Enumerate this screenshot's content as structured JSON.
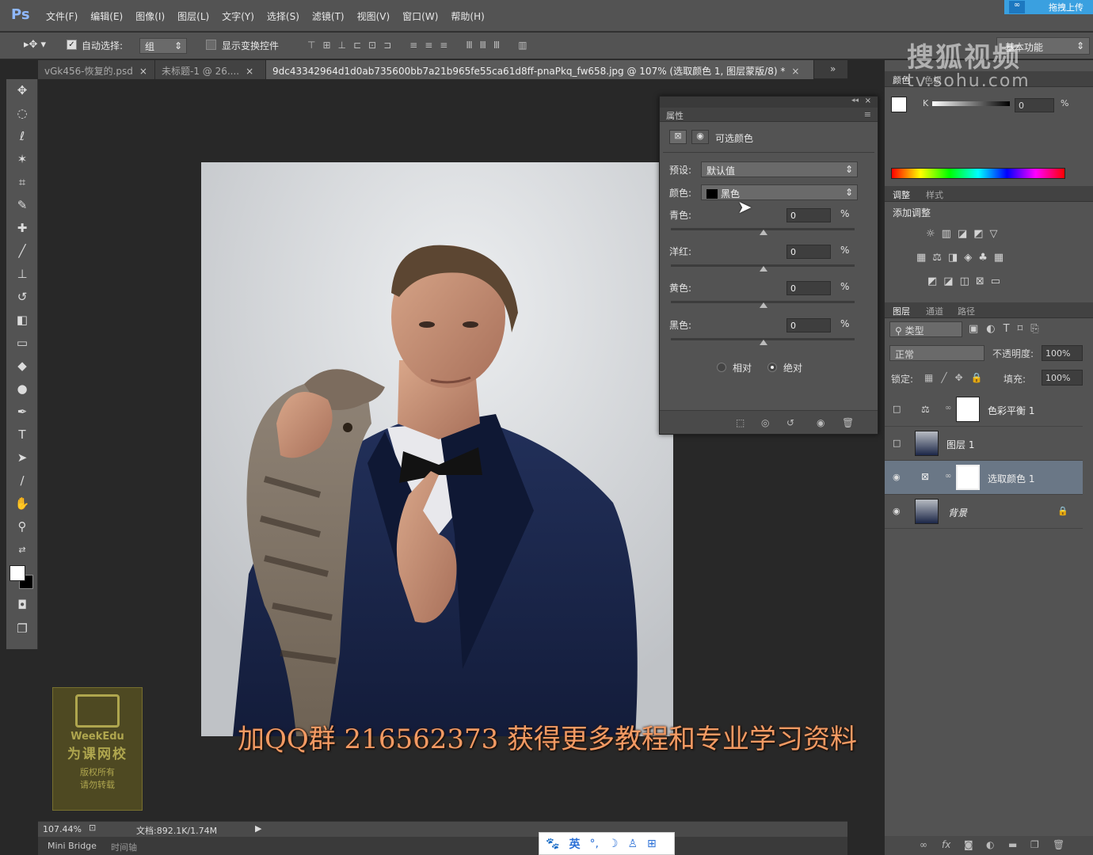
{
  "app": {
    "logo": "Ps",
    "menu": [
      "文件(F)",
      "编辑(E)",
      "图像(I)",
      "图层(L)",
      "文字(Y)",
      "选择(S)",
      "滤镜(T)",
      "视图(V)",
      "窗口(W)",
      "帮助(H)"
    ],
    "upload_label": "拖拽上传"
  },
  "options": {
    "auto_select_label": "自动选择:",
    "auto_select_value": "组",
    "show_transform_label": "显示变换控件",
    "workspace": "基本功能"
  },
  "tabs": [
    {
      "label": "vGk456-恢复的.psd",
      "close": "×"
    },
    {
      "label": "未标题-1 @ 26....",
      "close": "×"
    },
    {
      "label": "9dc43342964d1d0ab735600bb7a21b965fe55ca61d8ff-pnaPkq_fw658.jpg @ 107% (选取颜色 1, 图层蒙版/8) *",
      "close": "×"
    }
  ],
  "status": {
    "zoom": "107.44%",
    "doc": "文档:892.1K/1.74M",
    "minibridge": "Mini Bridge",
    "timeline": "时间轴"
  },
  "properties": {
    "title": "属性",
    "panel_name": "可选颜色",
    "preset_label": "预设:",
    "preset_value": "默认值",
    "color_label": "颜色:",
    "color_value": "黑色",
    "color_swatch": "#000000",
    "sliders": [
      {
        "label": "青色:",
        "value": "0",
        "unit": "%"
      },
      {
        "label": "洋红:",
        "value": "0",
        "unit": "%"
      },
      {
        "label": "黄色:",
        "value": "0",
        "unit": "%"
      },
      {
        "label": "黑色:",
        "value": "0",
        "unit": "%"
      }
    ],
    "relative": "相对",
    "absolute": "绝对",
    "method_selected": "absolute"
  },
  "color_panel": {
    "tabs": [
      "颜色",
      "色板"
    ],
    "channel": "K",
    "value": "0",
    "unit": "%"
  },
  "adjust_panel": {
    "tabs": [
      "调整",
      "样式"
    ],
    "add_label": "添加调整"
  },
  "layers_panel": {
    "tabs": [
      "图层",
      "通道",
      "路径"
    ],
    "filter": "类型",
    "blend": "正常",
    "opacity_label": "不透明度:",
    "opacity": "100%",
    "lock_label": "锁定:",
    "fill_label": "填充:",
    "fill": "100%",
    "layers": [
      {
        "name": "色彩平衡 1",
        "visible": false,
        "selected": false,
        "type": "adjustment"
      },
      {
        "name": "图层 1",
        "visible": false,
        "selected": false,
        "type": "pixel"
      },
      {
        "name": "选取颜色 1",
        "visible": true,
        "selected": true,
        "type": "adjustment"
      },
      {
        "name": "背景",
        "visible": true,
        "selected": false,
        "type": "background"
      }
    ]
  },
  "overlay": {
    "subtitle": "加QQ群 216562373 获得更多教程和专业学习资料",
    "watermark_cn": "搜狐视频",
    "watermark_url": "tv.sohu.com",
    "weekedu_line1": "WeekEdu",
    "weekedu_line2": "为课网校",
    "weekedu_line3": "版权所有",
    "weekedu_line4": "请勿转载",
    "ime_mode": "英"
  }
}
